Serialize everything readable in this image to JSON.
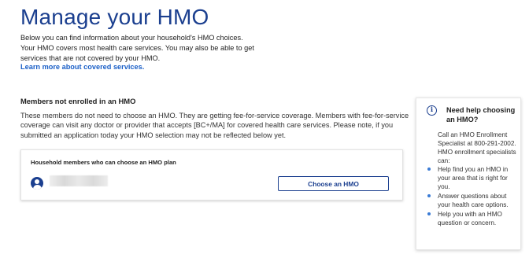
{
  "page": {
    "title": "Manage your HMO",
    "intro": "Below you can find information about your household's HMO choices. Your HMO covers most health care services. You may also be able to get services that are not covered by your HMO.",
    "learn_more_link": "Learn more about covered services."
  },
  "members_section": {
    "title": "Members not enrolled in an HMO",
    "body": "These members do not need to choose an HMO. They are getting fee-for-service coverage. Members with fee-for-service coverage can visit any doctor or provider that accepts [BC+/MA] for covered health care services. Please note, if you submitted an application today your HMO selection may not be reflected below yet.",
    "card": {
      "title": "Household members who can choose an HMO plan",
      "members": [
        {
          "avatar_icon": "person-icon",
          "choose_button_label": "Choose an HMO"
        }
      ]
    }
  },
  "help_panel": {
    "icon": "info-icon",
    "title": "Need help choosing an HMO?",
    "body": "Call an HMO Enrollment Specialist at 800-291-2002. HMO enrollment specialists can:",
    "items": [
      "Help find you an HMO in your area that is right for you.",
      "Answer questions about your health care options.",
      "Help you with an HMO question or concern."
    ]
  },
  "colors": {
    "brand_blue": "#1b3f8f",
    "link_blue": "#1a5fc7",
    "bullet_blue": "#3a7bd5"
  }
}
